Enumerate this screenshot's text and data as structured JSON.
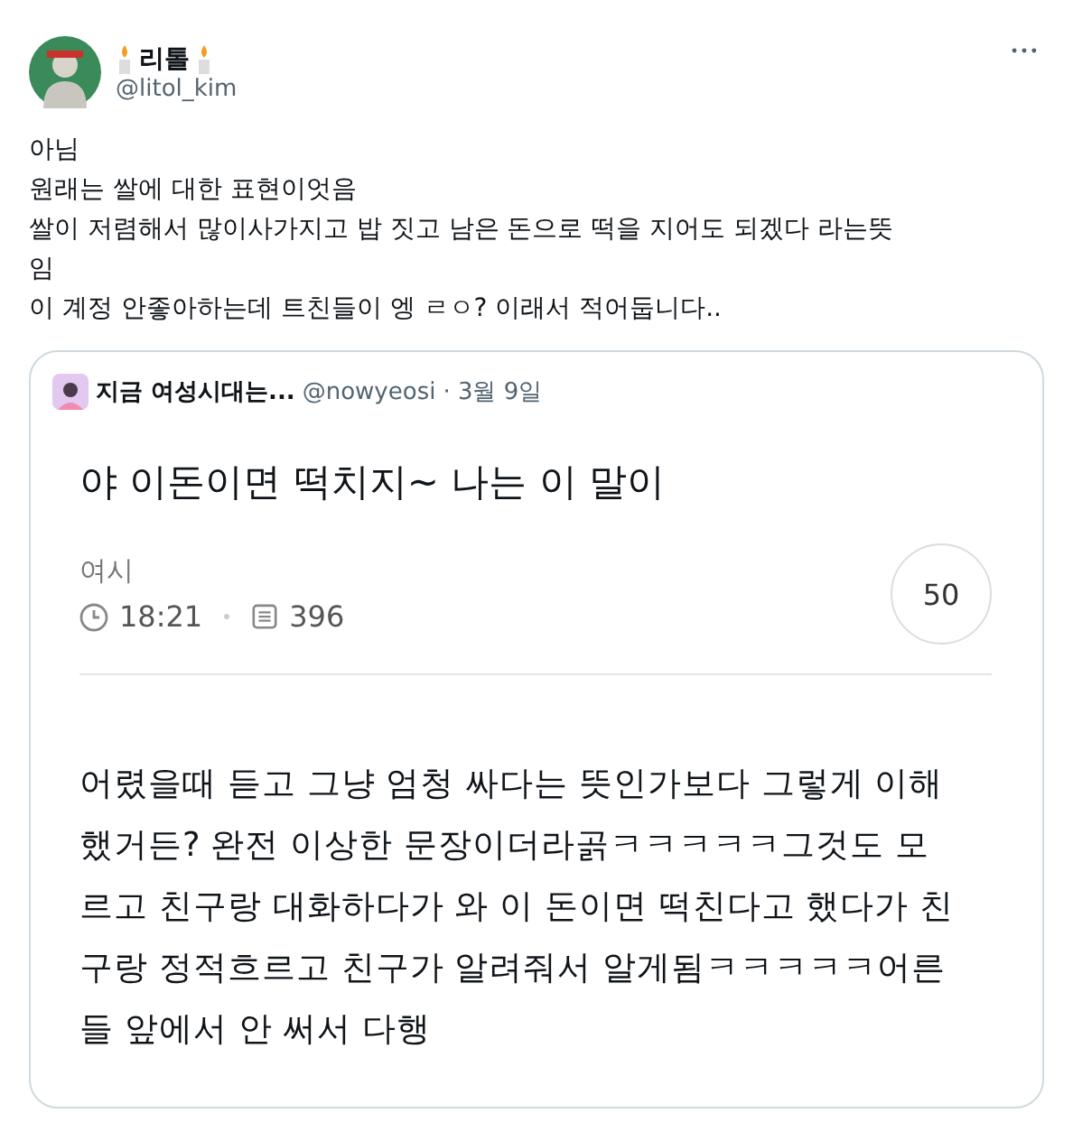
{
  "author": {
    "name": "리톨",
    "handle": "@litol_kim"
  },
  "tweet_lines": [
    "아님",
    "원래는 쌀에 대한 표현이엇음",
    "쌀이 저렴해서 많이사가지고 밥 짓고 남은 돈으로 떡을 지어도 되겠다 라는뜻",
    "임",
    "이 계정 안좋아하는데 트친들이 엥 ㄹㅇ? 이래서 적어둡니다.."
  ],
  "quote": {
    "name": "지금 여성시대는...",
    "handle": "@nowyeosi",
    "date": "· 3월 9일",
    "post": {
      "title": "야 이돈이면 떡치지~ 나는 이 말이",
      "board": "여시",
      "time": "18:21",
      "views": "396",
      "comments": "50",
      "body_lines": [
        "어렸을때 듣고 그냥 엄청 싸다는 뜻인가보다 그렇게 이해",
        "했거든? 완전 이상한 문장이더라곩ㅋㅋㅋㅋㅋ그것도 모",
        "르고 친구랑 대화하다가 와 이 돈이면 떡친다고 했다가 친",
        "구랑 정적흐르고 친구가 알려줘서 알게됨ㅋㅋㅋㅋㅋ어른",
        "들 앞에서 안 써서 다행"
      ]
    }
  }
}
